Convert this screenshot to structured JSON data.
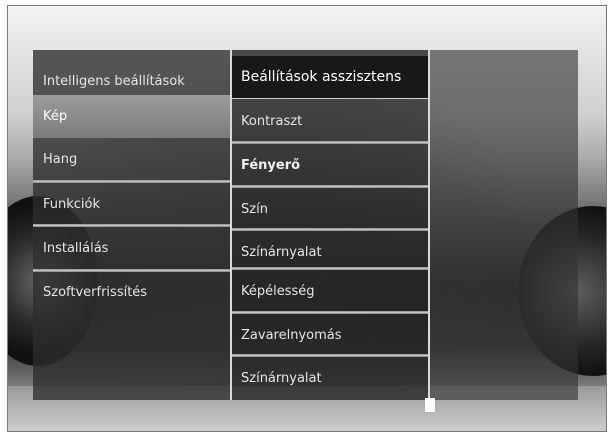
{
  "menu": {
    "main_items": [
      {
        "label": "Intelligens  beállítások"
      },
      {
        "label": "Kép"
      },
      {
        "label": "Hang"
      },
      {
        "label": "Funkciók"
      },
      {
        "label": "Installálás"
      },
      {
        "label": "Szoftverfrissítés"
      }
    ],
    "selected_main": "Kép",
    "sub_items": [
      {
        "label": "Beállítások asszisztens"
      },
      {
        "label": "Kontraszt"
      },
      {
        "label": "Fényerő"
      },
      {
        "label": "Szín"
      },
      {
        "label": "Színárnyalat"
      },
      {
        "label": "Képélesség"
      },
      {
        "label": "Zavarelnyomás"
      },
      {
        "label": "Színárnyalat"
      }
    ],
    "highlighted_sub": "Beállítások asszisztens"
  }
}
